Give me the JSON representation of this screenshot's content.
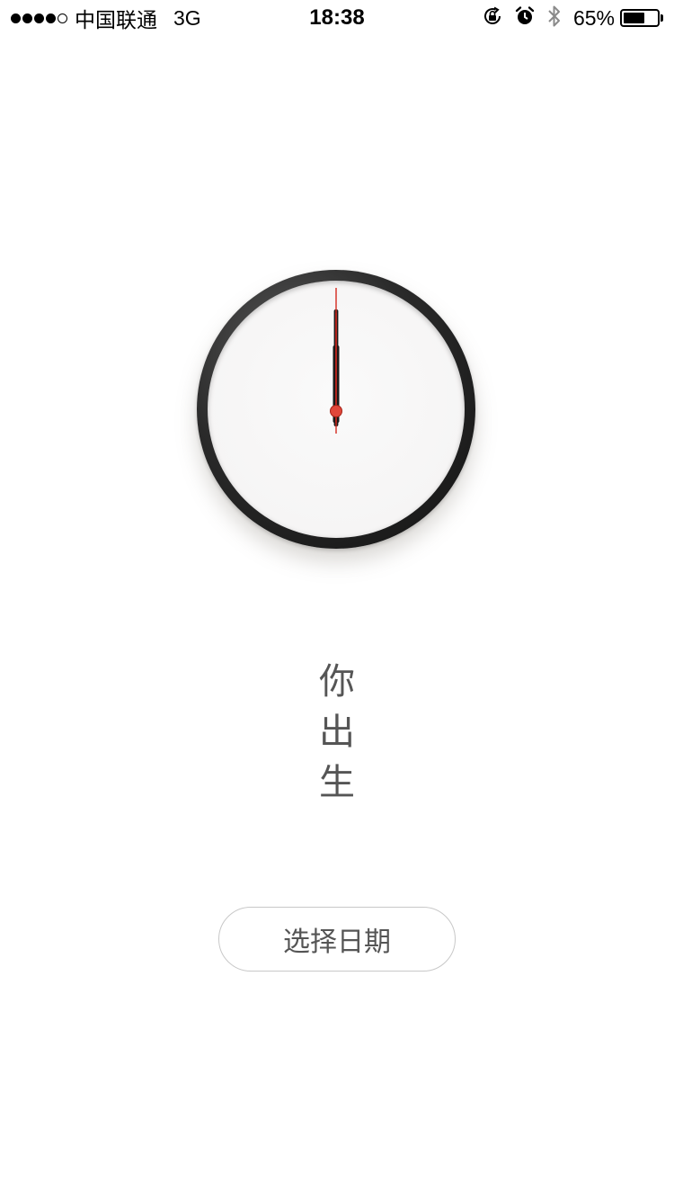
{
  "status_bar": {
    "signal_filled": 4,
    "signal_total": 5,
    "carrier": "中国联通",
    "network": "3G",
    "time": "18:38",
    "icons": [
      "orientation-lock-icon",
      "alarm-icon",
      "bluetooth-icon"
    ],
    "battery_percent_text": "65%",
    "battery_level": 0.65
  },
  "clock": {
    "hour": 12,
    "minute": 0,
    "second": 0,
    "hand_color": "#1a1a1a",
    "second_hand_color": "#d42a1e",
    "pivot_color": "#e0473a"
  },
  "main": {
    "vertical_text": [
      "你",
      "出",
      "生"
    ],
    "button_label": "选择日期"
  }
}
